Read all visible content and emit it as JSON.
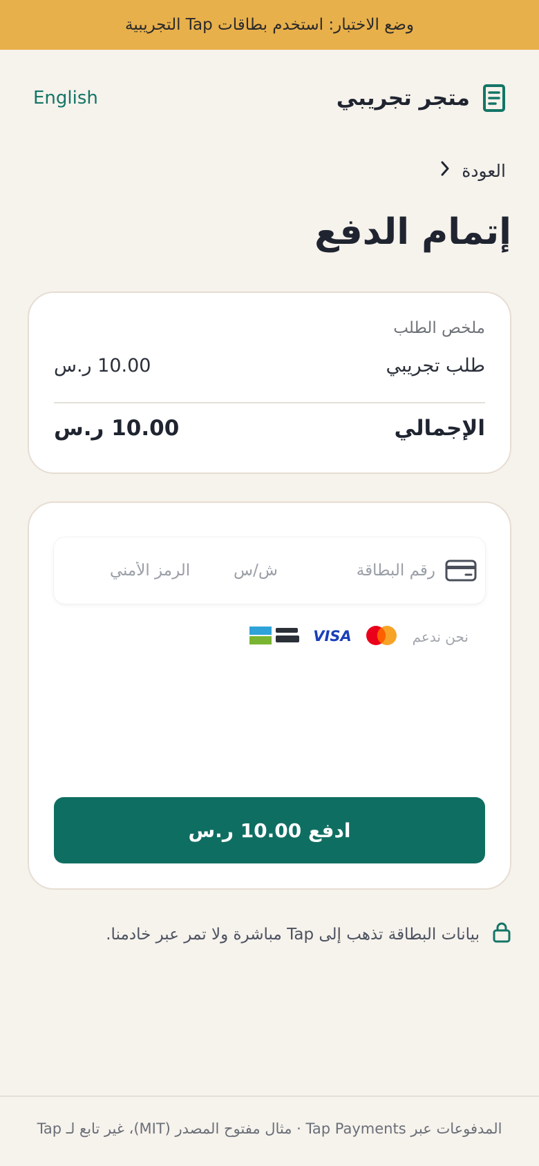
{
  "banner": {
    "text": "وضع الاختبار: استخدم بطاقات Tap التجريبية"
  },
  "header": {
    "store_name": "متجر تجريبي",
    "language_link": "English"
  },
  "nav": {
    "back_label": "العودة"
  },
  "page": {
    "title": "إتمام الدفع"
  },
  "order_summary": {
    "heading": "ملخص الطلب",
    "item_label": "طلب تجريبي",
    "item_amount": "10.00 ر.س",
    "total_label": "الإجمالي",
    "total_amount": "10.00 ر.س"
  },
  "payment_form": {
    "card_number_placeholder": "رقم البطاقة",
    "expiry_placeholder": "ش/س",
    "cvv_placeholder": "الرمز الأمني",
    "supported_label": "نحن ندعم",
    "brands": [
      "mastercard-logo",
      "visa-logo",
      "mada-logo"
    ],
    "pay_button_label": "ادفع 10.00 ر.س"
  },
  "security_note": "بيانات البطاقة تذهب إلى Tap مباشرة ولا تمر عبر خادمنا.",
  "footer": "المدفوعات عبر Tap Payments · مثال مفتوح المصدر (MIT)، غير تابع لـ Tap",
  "colors": {
    "banner": "#e8b04b",
    "accent": "#0f6e62",
    "background": "#f6f2ec",
    "text": "#1f2430"
  }
}
